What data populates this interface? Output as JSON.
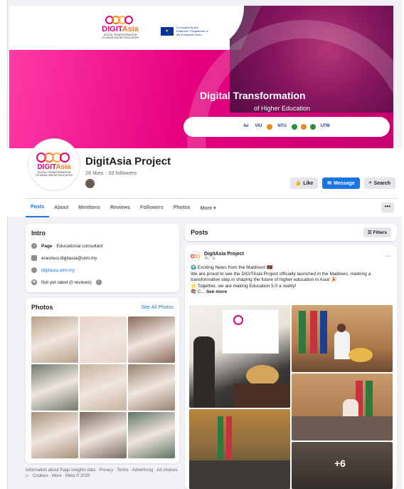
{
  "cover": {
    "logo_name_pink": "DIGIT",
    "logo_name_orange": "Asia",
    "logo_subtitle_1": "DIGITAL TRANSFORMATION",
    "logo_subtitle_2": "OF ASIAN HIGHER EDUCATION",
    "eu_text": "Co-funded by the Erasmus+ Programme of the European Union",
    "title": "Digital Transformation",
    "subtitle": "of Higher Education",
    "partners": [
      "fai",
      "VIU",
      "NTU",
      "UTM"
    ]
  },
  "profile": {
    "name": "DigitAsia Project",
    "stats": "26 likes · 33 followers",
    "like_label": "Like",
    "message_label": "Message",
    "search_label": "Search"
  },
  "tabs": [
    "Posts",
    "About",
    "Mentions",
    "Reviews",
    "Followers",
    "Photos",
    "More ▾"
  ],
  "more_button": "•••",
  "intro": {
    "title": "Intro",
    "category_bold": "Page",
    "category_rest": " · Educational consultant",
    "email": "erasmus.digitasia@utm.my",
    "website": "digitasia.utm.my",
    "rating": "Not yet rated (0 reviews)"
  },
  "photos": {
    "title": "Photos",
    "see_all": "See All Photos",
    "thumb_colors": [
      "#b9a189",
      "#e8d4c8",
      "#8b6a5c",
      "#6e7a6b",
      "#c7b29e",
      "#98826e",
      "#a8917a",
      "#7c6b5e",
      "#5f7466"
    ]
  },
  "footer": "Information about Page Insights data · Privacy · Terms · Advertising · Ad choices ▷ · Cookies · More · Meta © 2025",
  "posts": {
    "title": "Posts",
    "filters_label": "Filters"
  },
  "post": {
    "author": "DigitAsia Project",
    "time": "7h · ⊙",
    "line1": "🌍 Exciting News from the Maldives! 🇲🇻",
    "line2": "We are proud to see the DIGITAsia Project officially launched in the Maldives, marking a transformative step in shaping the future of higher education in Asia! 🎉",
    "line3": "🌟 Together, we are making Education 5.0 a reality!",
    "line4": "📚 C...",
    "see_more": "See more",
    "extra_count": "+6"
  }
}
